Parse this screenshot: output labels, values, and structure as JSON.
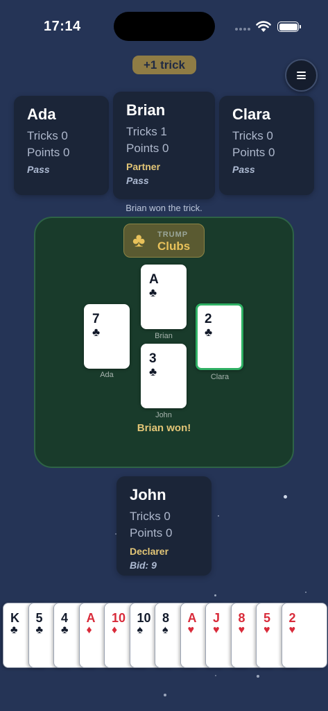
{
  "status_bar": {
    "time": "17:14"
  },
  "trick_pill": "+1 trick",
  "players": {
    "ada": {
      "name": "Ada",
      "tricks": "Tricks 0",
      "points": "Points 0",
      "bid": "Pass"
    },
    "brian": {
      "name": "Brian",
      "tricks": "Tricks 1",
      "points": "Points 0",
      "role": "Partner",
      "bid": "Pass"
    },
    "clara": {
      "name": "Clara",
      "tricks": "Tricks 0",
      "points": "Points 0",
      "bid": "Pass"
    },
    "john": {
      "name": "John",
      "tricks": "Tricks 0",
      "points": "Points 0",
      "role": "Declarer",
      "bid": "Bid: 9"
    }
  },
  "trick_status": "Brian won the trick.",
  "trump": {
    "label": "TRUMP",
    "suit": "Clubs",
    "icon": "club-icon"
  },
  "table_cards": {
    "brian": {
      "rank": "A",
      "suit": "♣",
      "seat": "Brian"
    },
    "ada": {
      "rank": "7",
      "suit": "♣",
      "seat": "Ada"
    },
    "clara": {
      "rank": "2",
      "suit": "♣",
      "seat": "Clara"
    },
    "john": {
      "rank": "3",
      "suit": "♣",
      "seat": "John"
    }
  },
  "winner_text": "Brian won!",
  "hand": [
    {
      "rank": "K",
      "suit": "♣",
      "color": "black"
    },
    {
      "rank": "5",
      "suit": "♣",
      "color": "black"
    },
    {
      "rank": "4",
      "suit": "♣",
      "color": "black"
    },
    {
      "rank": "A",
      "suit": "♦",
      "color": "red"
    },
    {
      "rank": "10",
      "suit": "♦",
      "color": "red"
    },
    {
      "rank": "10",
      "suit": "♠",
      "color": "black"
    },
    {
      "rank": "8",
      "suit": "♠",
      "color": "black"
    },
    {
      "rank": "A",
      "suit": "♥",
      "color": "red"
    },
    {
      "rank": "J",
      "suit": "♥",
      "color": "red"
    },
    {
      "rank": "8",
      "suit": "♥",
      "color": "red"
    },
    {
      "rank": "5",
      "suit": "♥",
      "color": "red"
    },
    {
      "rank": "2",
      "suit": "♥",
      "color": "red"
    }
  ],
  "colors": {
    "background": "#253456",
    "felt": "#193b2b",
    "accent_gold": "#e3c677",
    "winner_border": "#2fb064"
  }
}
